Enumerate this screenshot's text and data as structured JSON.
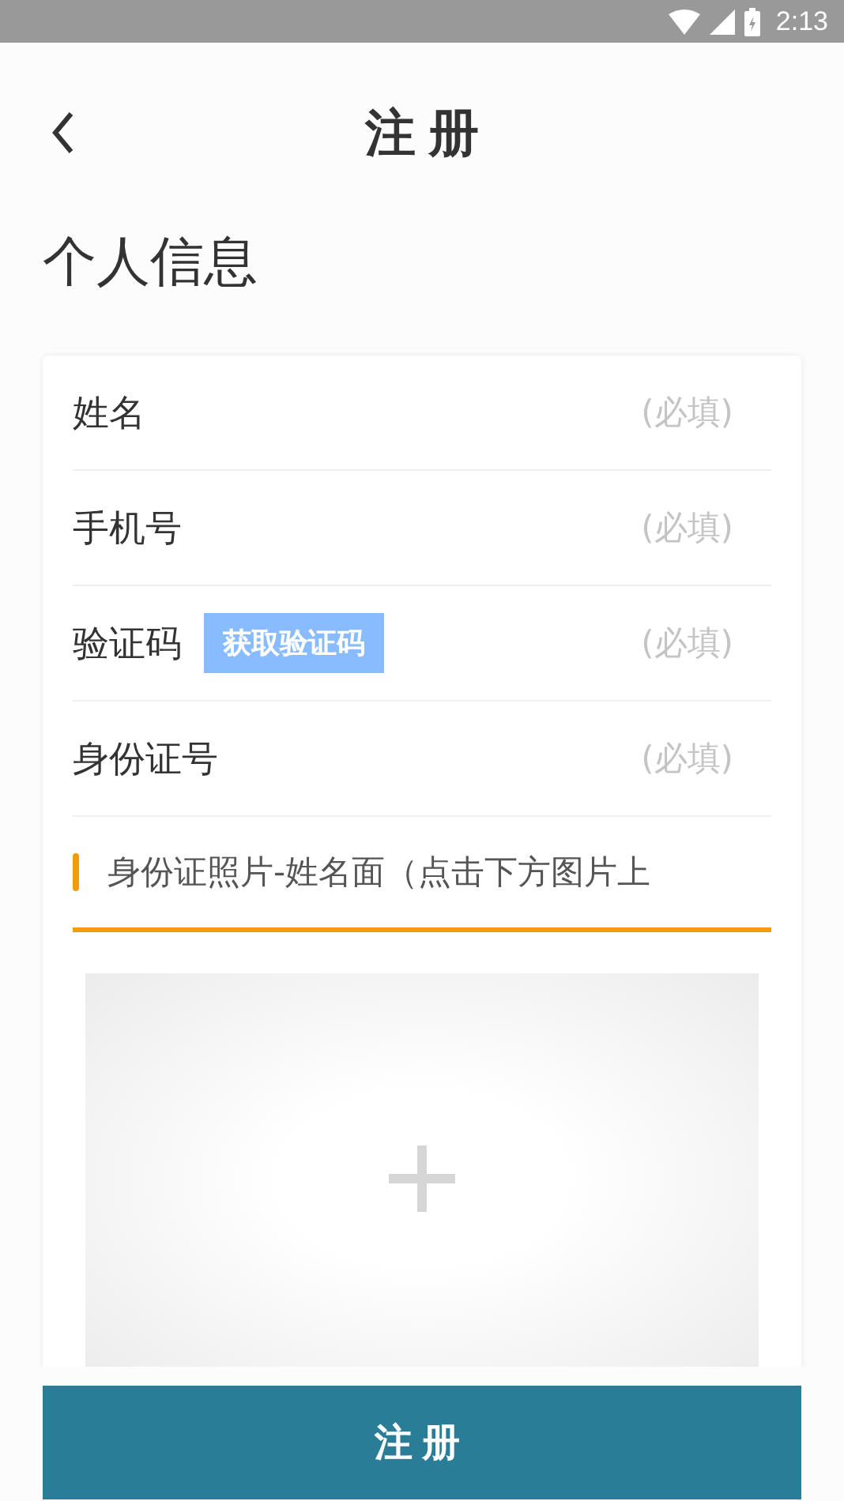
{
  "status_bar": {
    "time": "2:13"
  },
  "header": {
    "title": "注册"
  },
  "section_title": "个人信息",
  "fields": [
    {
      "kind": "text",
      "label": "姓名",
      "placeholder": "(必填)"
    },
    {
      "kind": "text",
      "label": "手机号",
      "placeholder": "(必填)"
    },
    {
      "kind": "code",
      "label": "验证码",
      "button": "获取验证码",
      "placeholder": "(必填)"
    },
    {
      "kind": "text",
      "label": "身份证号",
      "placeholder": "(必填)"
    }
  ],
  "photo_section": {
    "label": "身份证照片-姓名面（点击下方图片上"
  },
  "submit_button": "注册"
}
